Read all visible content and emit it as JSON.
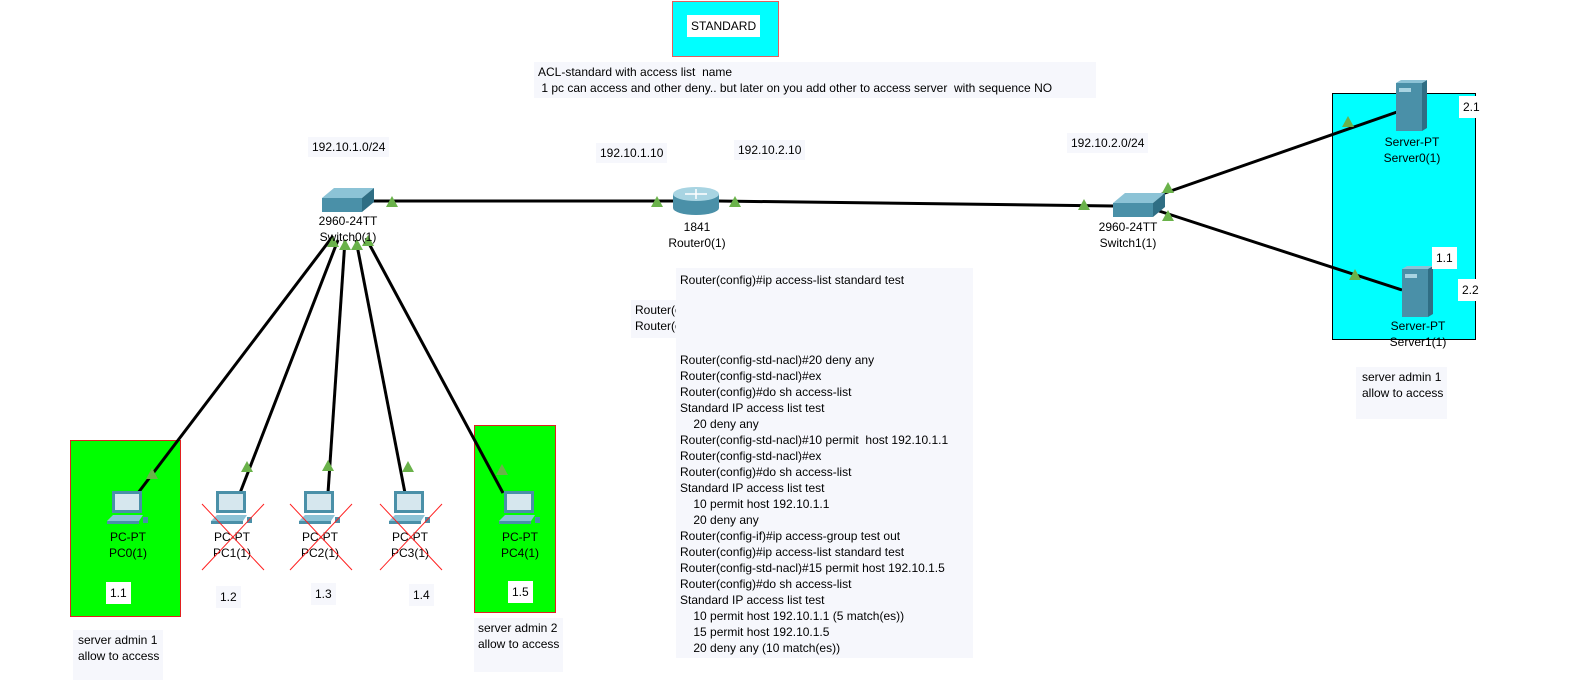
{
  "title_box": {
    "label": "STANDARD",
    "fill": "#00ffff",
    "border": "#e06060"
  },
  "description_note": "ACL-standard with access list  name\n 1 pc can access and other deny.. but later on you add other to access server  with sequence NO",
  "network_labels": {
    "lan1": "192.10.1.0/24",
    "router_g0": "192.10.1.10",
    "router_g1": "192.10.2.10",
    "lan2": "192.10.2.0/24"
  },
  "devices": {
    "switch0": {
      "model": "2960-24TT",
      "name": "Switch0(1)"
    },
    "router0": {
      "model": "1841",
      "name": "Router0(1)"
    },
    "switch1": {
      "model": "2960-24TT",
      "name": "Switch1(1)"
    },
    "server0": {
      "model": "Server-PT",
      "name": "Server0(1)",
      "addr": "2.1"
    },
    "server1": {
      "model": "Server-PT",
      "name": "Server1(1)",
      "addr": "2.2",
      "extra_label": "1.1"
    },
    "pcs": [
      {
        "model": "PC-PT",
        "name": "PC0(1)",
        "addr": "1.1",
        "denied": false
      },
      {
        "model": "PC-PT",
        "name": "PC1(1)",
        "addr": "1.2",
        "denied": true
      },
      {
        "model": "PC-PT",
        "name": "PC2(1)",
        "addr": "1.3",
        "denied": true
      },
      {
        "model": "PC-PT",
        "name": "PC3(1)",
        "addr": "1.4",
        "denied": true
      },
      {
        "model": "PC-PT",
        "name": "PC4(1)",
        "addr": "1.5",
        "denied": false
      }
    ]
  },
  "notes": {
    "admin_left": "server admin 1\nallow to access",
    "admin_pc4": "server admin 2\nallow to access",
    "admin_right": "server admin 1\nallow to access",
    "hidden_router": "Router(c\nRouter(c"
  },
  "cli_output": "Router(config)#ip access-list standard test\n\n\n\n\nRouter(config-std-nacl)#20 deny any\nRouter(config-std-nacl)#ex\nRouter(config)#do sh access-list\nStandard IP access list test\n    20 deny any\nRouter(config-std-nacl)#10 permit  host 192.10.1.1\nRouter(config-std-nacl)#ex\nRouter(config)#do sh access-list\nStandard IP access list test\n    10 permit host 192.10.1.1\n    20 deny any\nRouter(config-if)#ip access-group test out\nRouter(config)#ip access-list standard test\nRouter(config-std-nacl)#15 permit host 192.10.1.5\nRouter(config)#do sh access-list\nStandard IP access list test\n    10 permit host 192.10.1.1 (5 match(es))\n    15 permit host 192.10.1.5\n    20 deny any (10 match(es))",
  "colors": {
    "allowed_area": "#00ff00",
    "server_area": "#00ffff",
    "link_up": "#6ab24a",
    "deny_mark": "#ff2020",
    "device": "#4a90a8"
  }
}
